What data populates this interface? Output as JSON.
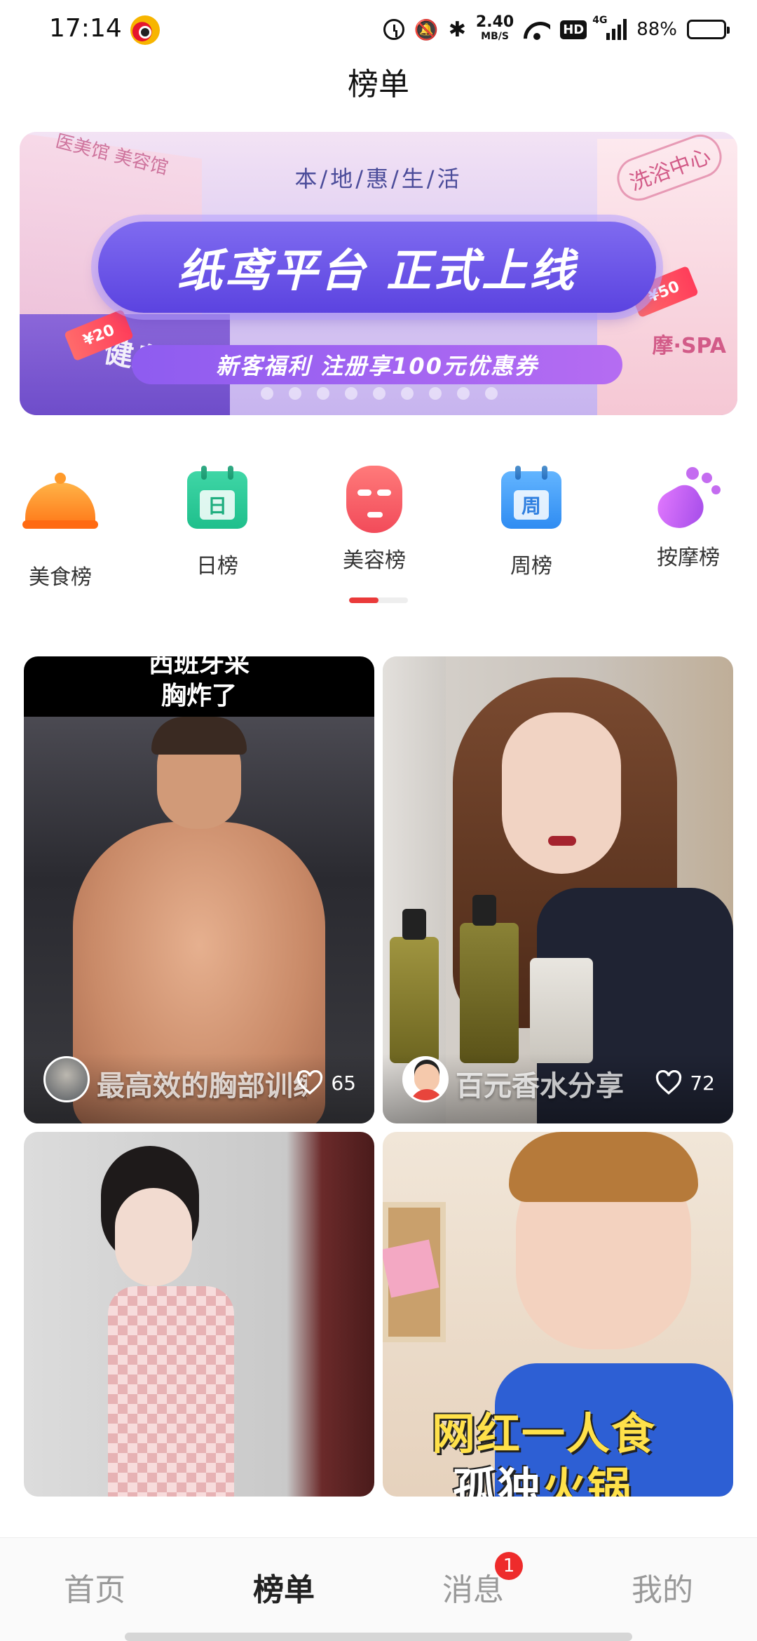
{
  "status_bar": {
    "time": "17:14",
    "app_icon": "weibo-icon",
    "net_speed_value": "2.40",
    "net_speed_unit": "MB/S",
    "hd": "HD",
    "network_type": "4G",
    "battery_percent": "88%",
    "battery_level": 0.88
  },
  "header": {
    "title": "榜单"
  },
  "banner": {
    "subtitle": "本/地/惠/生/活",
    "main_text": "纸鸢平台 正式上线",
    "promo_text": "新客福利  注册享100元优惠券",
    "left_sign_top": "医美馆 美容馆",
    "left_sign_main": "健身房",
    "right_sign_top": "洗浴中心",
    "right_sign_bottom": "摩·SPA",
    "coupon_left": "¥20",
    "coupon_right": "¥50"
  },
  "categories": [
    {
      "label": "美食榜",
      "icon": "cloche-icon"
    },
    {
      "label": "日榜",
      "icon": "calendar-day-icon",
      "glyph": "日"
    },
    {
      "label": "美容榜",
      "icon": "face-mask-icon"
    },
    {
      "label": "周榜",
      "icon": "calendar-week-icon",
      "glyph": "周"
    },
    {
      "label": "按摩榜",
      "icon": "foot-icon"
    }
  ],
  "feed": [
    {
      "caption": "西班牙采\n胸炸了",
      "title": "最高效的胸部训练",
      "likes": "65"
    },
    {
      "title": "百元香水分享",
      "likes": "72"
    },
    {
      "title": ""
    },
    {
      "caption_line1": "网红一人食",
      "caption_line2_a": "孤独",
      "caption_line2_b": "火锅",
      "title": ""
    }
  ],
  "bottom_nav": {
    "items": [
      "首页",
      "榜单",
      "消息",
      "我的"
    ],
    "active_index": 1,
    "message_badge": "1"
  },
  "colors": {
    "accent_red": "#ea3a3a",
    "banner_purple": "#5b43e0",
    "badge_red": "#ee2b2b"
  }
}
